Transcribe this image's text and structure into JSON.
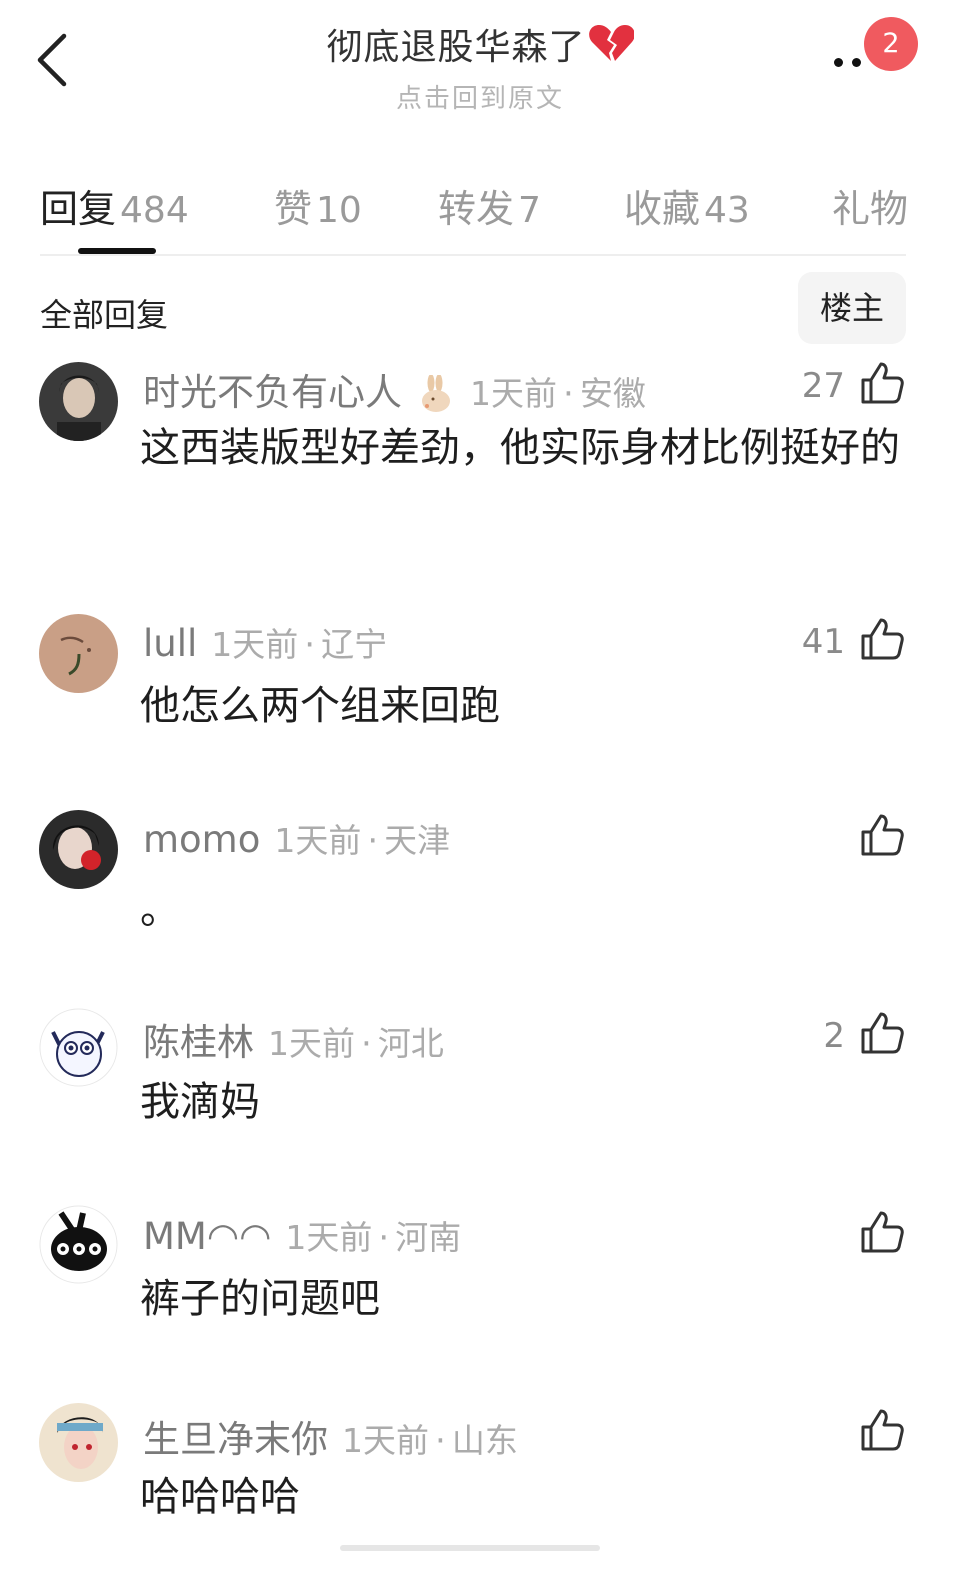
{
  "header": {
    "title": "彻底退股华森了",
    "subtitle": "点击回到原文",
    "notification_count": "2"
  },
  "tabs": [
    {
      "label": "回复",
      "count": "484"
    },
    {
      "label": "赞",
      "count": "10"
    },
    {
      "label": "转发",
      "count": "7"
    },
    {
      "label": "收藏",
      "count": "43"
    },
    {
      "label": "礼物",
      "count": ""
    }
  ],
  "section": {
    "title": "全部回复",
    "filter_label": "楼主"
  },
  "comments": [
    {
      "username": "时光不负有心人",
      "time": "1天前",
      "location": "安徽",
      "likes": "27",
      "text": "这西装版型好差劲，他实际身材比例挺好的"
    },
    {
      "username": "lull",
      "time": "1天前",
      "location": "辽宁",
      "likes": "41",
      "text": "他怎么两个组来回跑"
    },
    {
      "username": "momo",
      "time": "1天前",
      "location": "天津",
      "likes": "",
      "text": "。"
    },
    {
      "username": "陈桂林",
      "time": "1天前",
      "location": "河北",
      "likes": "2",
      "text": "我滴妈"
    },
    {
      "username": "MM◠◠",
      "time": "1天前",
      "location": "河南",
      "likes": "",
      "text": "裤子的问题吧"
    },
    {
      "username": "生旦净末你",
      "time": "1天前",
      "location": "山东",
      "likes": "",
      "text": "哈哈哈哈"
    }
  ],
  "colors": {
    "badge": "#f05a5f",
    "username": "#7a7a7a",
    "meta": "#ababab"
  }
}
